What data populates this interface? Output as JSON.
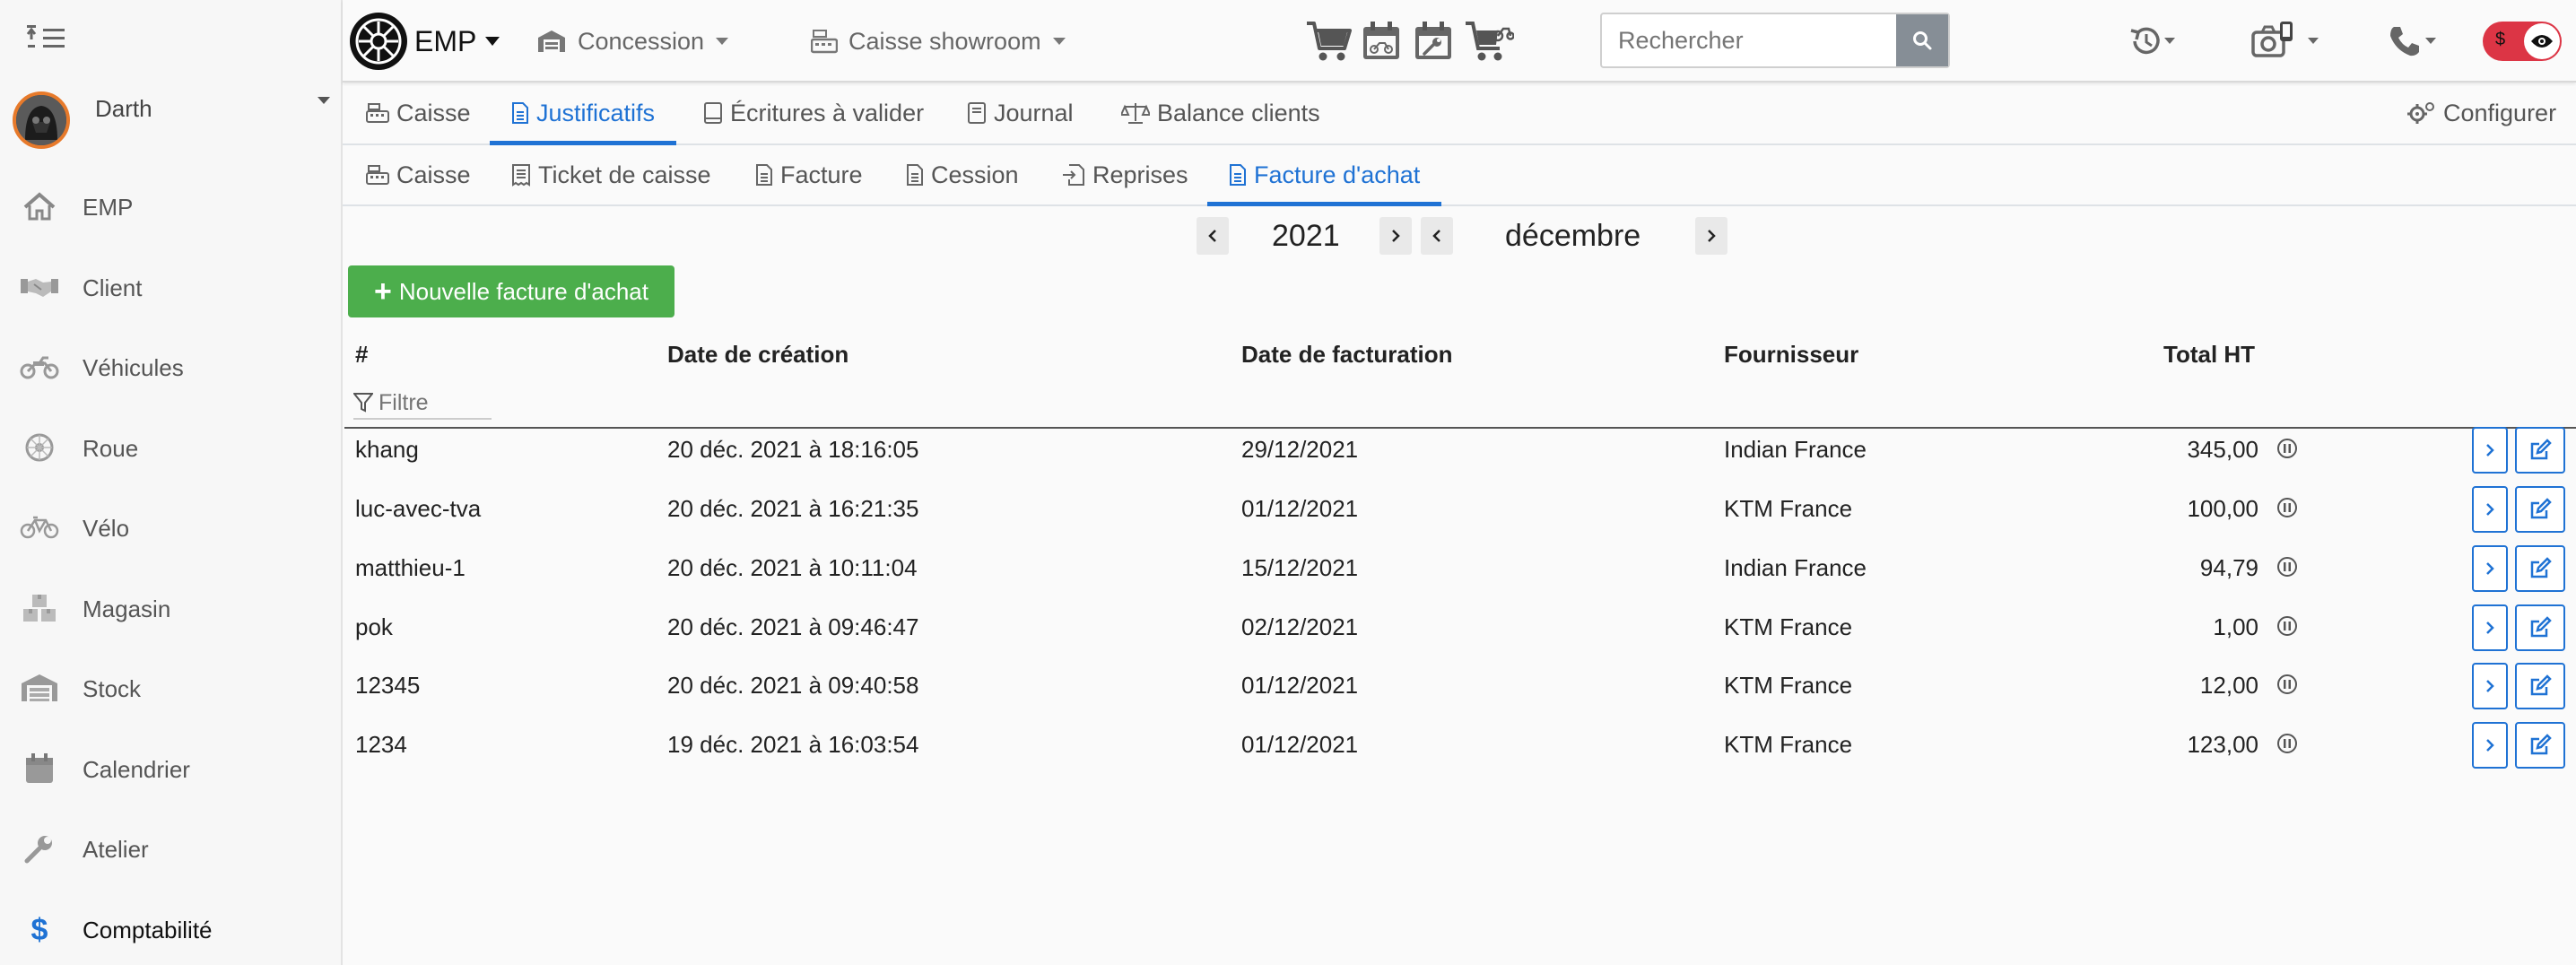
{
  "topbar": {
    "brand": "EMP",
    "concession_label": "Concession",
    "caisse_label": "Caisse showroom",
    "search_placeholder": "Rechercher"
  },
  "sidebar": {
    "user_name": "Darth",
    "items": [
      {
        "label": "EMP",
        "icon": "home-icon"
      },
      {
        "label": "Client",
        "icon": "handshake-icon"
      },
      {
        "label": "Véhicules",
        "icon": "motorcycle-icon"
      },
      {
        "label": "Roue",
        "icon": "wheel-icon"
      },
      {
        "label": "Vélo",
        "icon": "bicycle-icon"
      },
      {
        "label": "Magasin",
        "icon": "boxes-icon"
      },
      {
        "label": "Stock",
        "icon": "warehouse-icon"
      },
      {
        "label": "Calendrier",
        "icon": "calendar-icon"
      },
      {
        "label": "Atelier",
        "icon": "wrench-icon"
      },
      {
        "label": "Comptabilité",
        "icon": "dollar-icon"
      }
    ]
  },
  "tabs_main": [
    {
      "label": "Caisse"
    },
    {
      "label": "Justificatifs"
    },
    {
      "label": "Écritures à valider"
    },
    {
      "label": "Journal"
    },
    {
      "label": "Balance clients"
    }
  ],
  "configure_label": "Configurer",
  "tabs_sub": [
    {
      "label": "Caisse"
    },
    {
      "label": "Ticket de caisse"
    },
    {
      "label": "Facture"
    },
    {
      "label": "Cession"
    },
    {
      "label": "Reprises"
    },
    {
      "label": "Facture d'achat"
    }
  ],
  "period": {
    "year": "2021",
    "month": "décembre"
  },
  "new_button_label": "Nouvelle facture d'achat",
  "table": {
    "headers": [
      "#",
      "Date de création",
      "Date de facturation",
      "Fournisseur",
      "Total HT"
    ],
    "filter_placeholder": "Filtre",
    "rows": [
      {
        "id": "khang",
        "created": "20 déc. 2021 à 18:16:05",
        "billed": "29/12/2021",
        "supplier": "Indian France",
        "total": "345,00"
      },
      {
        "id": "luc-avec-tva",
        "created": "20 déc. 2021 à 16:21:35",
        "billed": "01/12/2021",
        "supplier": "KTM France",
        "total": "100,00"
      },
      {
        "id": "matthieu-1",
        "created": "20 déc. 2021 à 10:11:04",
        "billed": "15/12/2021",
        "supplier": "Indian France",
        "total": "94,79"
      },
      {
        "id": "pok",
        "created": "20 déc. 2021 à 09:46:47",
        "billed": "02/12/2021",
        "supplier": "KTM France",
        "total": "1,00"
      },
      {
        "id": "12345",
        "created": "20 déc. 2021 à 09:40:58",
        "billed": "01/12/2021",
        "supplier": "KTM France",
        "total": "12,00"
      },
      {
        "id": "1234",
        "created": "19 déc. 2021 à 16:03:54",
        "billed": "01/12/2021",
        "supplier": "KTM France",
        "total": "123,00"
      }
    ]
  },
  "colors": {
    "accent": "#1f72d4",
    "success": "#4cae4c",
    "danger": "#dc3545"
  }
}
